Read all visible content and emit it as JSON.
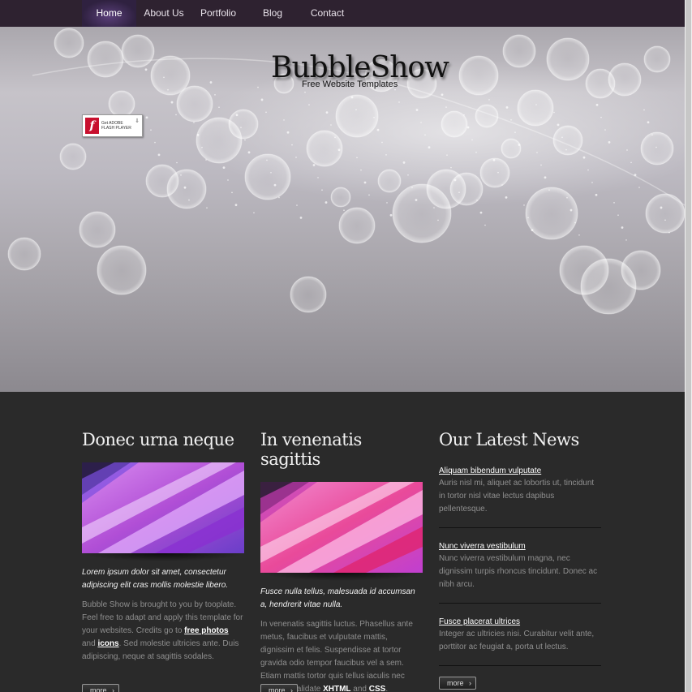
{
  "nav": {
    "items": [
      {
        "label": "Home",
        "active": true
      },
      {
        "label": "About Us",
        "active": false
      },
      {
        "label": "Portfolio",
        "active": false
      },
      {
        "label": "Blog",
        "active": false
      },
      {
        "label": "Contact",
        "active": false
      }
    ]
  },
  "hero": {
    "logo": "BubbleShow",
    "tagline": "Free Website Templates",
    "flash_badge": {
      "line1": "Get ADOBE",
      "line2": "FLASH PLAYER"
    }
  },
  "col1": {
    "title": "Donec urna neque",
    "lead": "Lorem ipsum dolor sit amet, consectetur adipiscing elit cras mollis molestie libero.",
    "body_before": "Bubble Show is brought to you by tooplate. Feel free to adapt and apply this template for your websites. Credits go to ",
    "link1": "free photos",
    "and": " and ",
    "link2": "icons",
    "body_after": ". Sed molestie ultricies ante. Duis adipiscing, neque at sagittis sodales.",
    "more": "more"
  },
  "col2": {
    "title": "In venenatis sagittis",
    "lead": "Fusce nulla tellus, malesuada id accumsan a, hendrerit vitae nulla.",
    "body_before": "In venenatis sagittis luctus. Phasellus ante metus, faucibus et vulputate mattis, dignissim et felis. Suspendisse at tortor gravida odio tempor faucibus vel a sem. Etiam mattis tortor quis tellus iaculis nec suscipit. Validate ",
    "link1": "XHTML",
    "and": " and ",
    "link2": "CSS",
    "body_after": ".",
    "more": "more"
  },
  "news": {
    "title": "Our Latest News",
    "items": [
      {
        "title": "Aliquam bibendum vulputate",
        "desc": "Auris nisl mi, aliquet ac lobortis ut, tincidunt in tortor nisl vitae lectus dapibus pellentesque."
      },
      {
        "title": "Nunc viverra vestibulum",
        "desc": "Nunc viverra vestibulum magna, nec dignissim turpis rhoncus tincidunt. Donec ac nibh arcu."
      },
      {
        "title": "Fusce placerat ultrices",
        "desc": "Integer ac ultricies nisi. Curabitur velit ante, porttitor ac feugiat a, porta ut lectus."
      }
    ],
    "more": "more"
  }
}
